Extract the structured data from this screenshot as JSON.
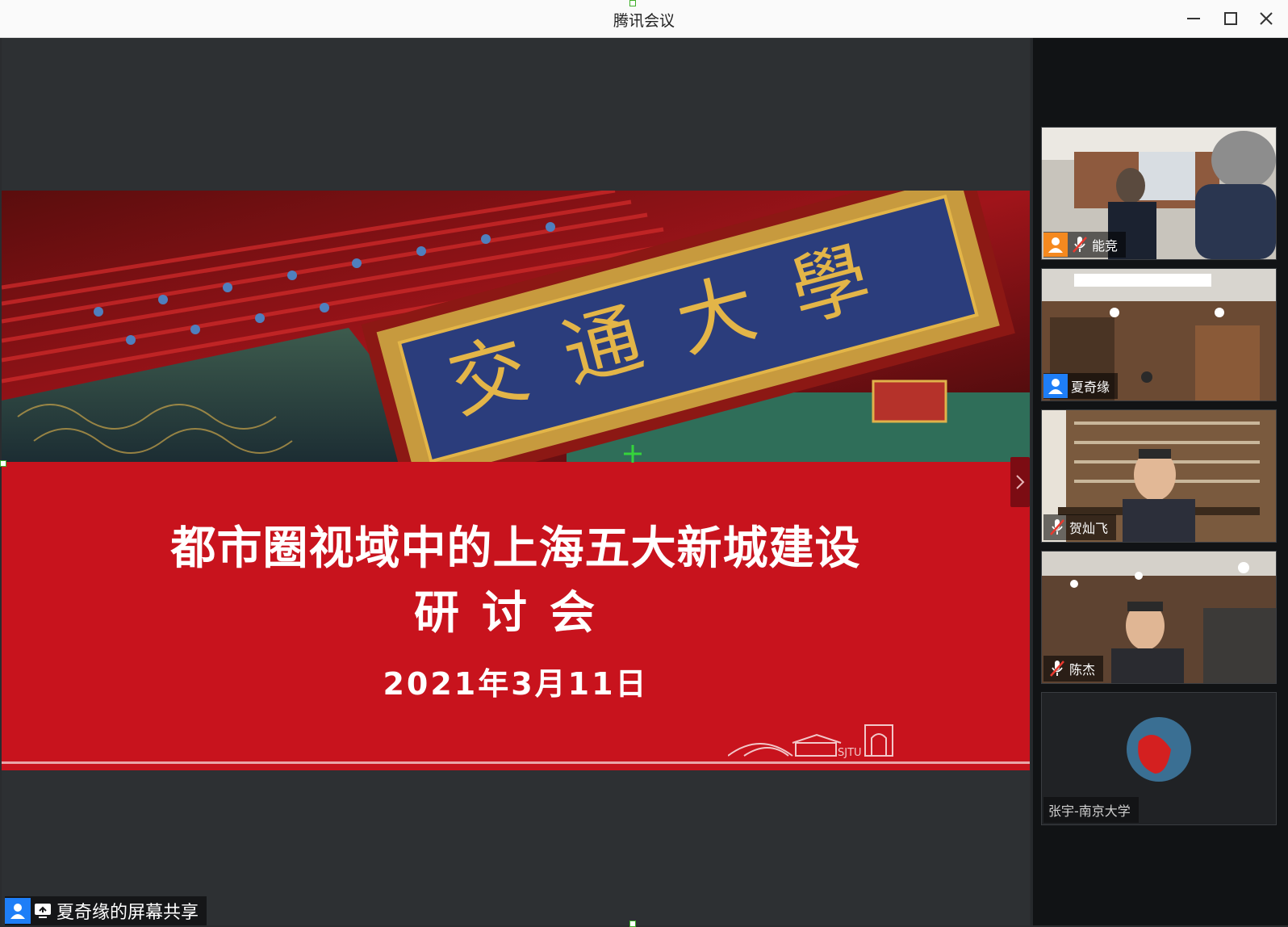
{
  "window": {
    "title": "腾讯会议"
  },
  "slide": {
    "plaque_text": "交通大學",
    "title_line1": "都市圈视域中的上海五大新城建设",
    "title_line2": "研讨会",
    "date": "2021年3月11日",
    "logo_text": "SJTU"
  },
  "participants": [
    {
      "name": "能竞",
      "avatar": "person-icon",
      "avatar_color": "#f5891f",
      "mic_muted": true
    },
    {
      "name": "夏奇缘",
      "avatar": "person-icon",
      "avatar_color": "#1e7ef7",
      "mic_muted": false
    },
    {
      "name": "贺灿飞",
      "mic_muted": true
    },
    {
      "name": "陈杰",
      "mic_muted": true
    },
    {
      "name": "张宇-南京大学",
      "video_off": true
    }
  ],
  "share": {
    "label": "夏奇缘的屏幕共享",
    "avatar_color": "#1e7ef7"
  },
  "colors": {
    "slide_red": "#c8131d",
    "plaque_blue": "#2b3d7c",
    "gold": "#e3b548"
  }
}
